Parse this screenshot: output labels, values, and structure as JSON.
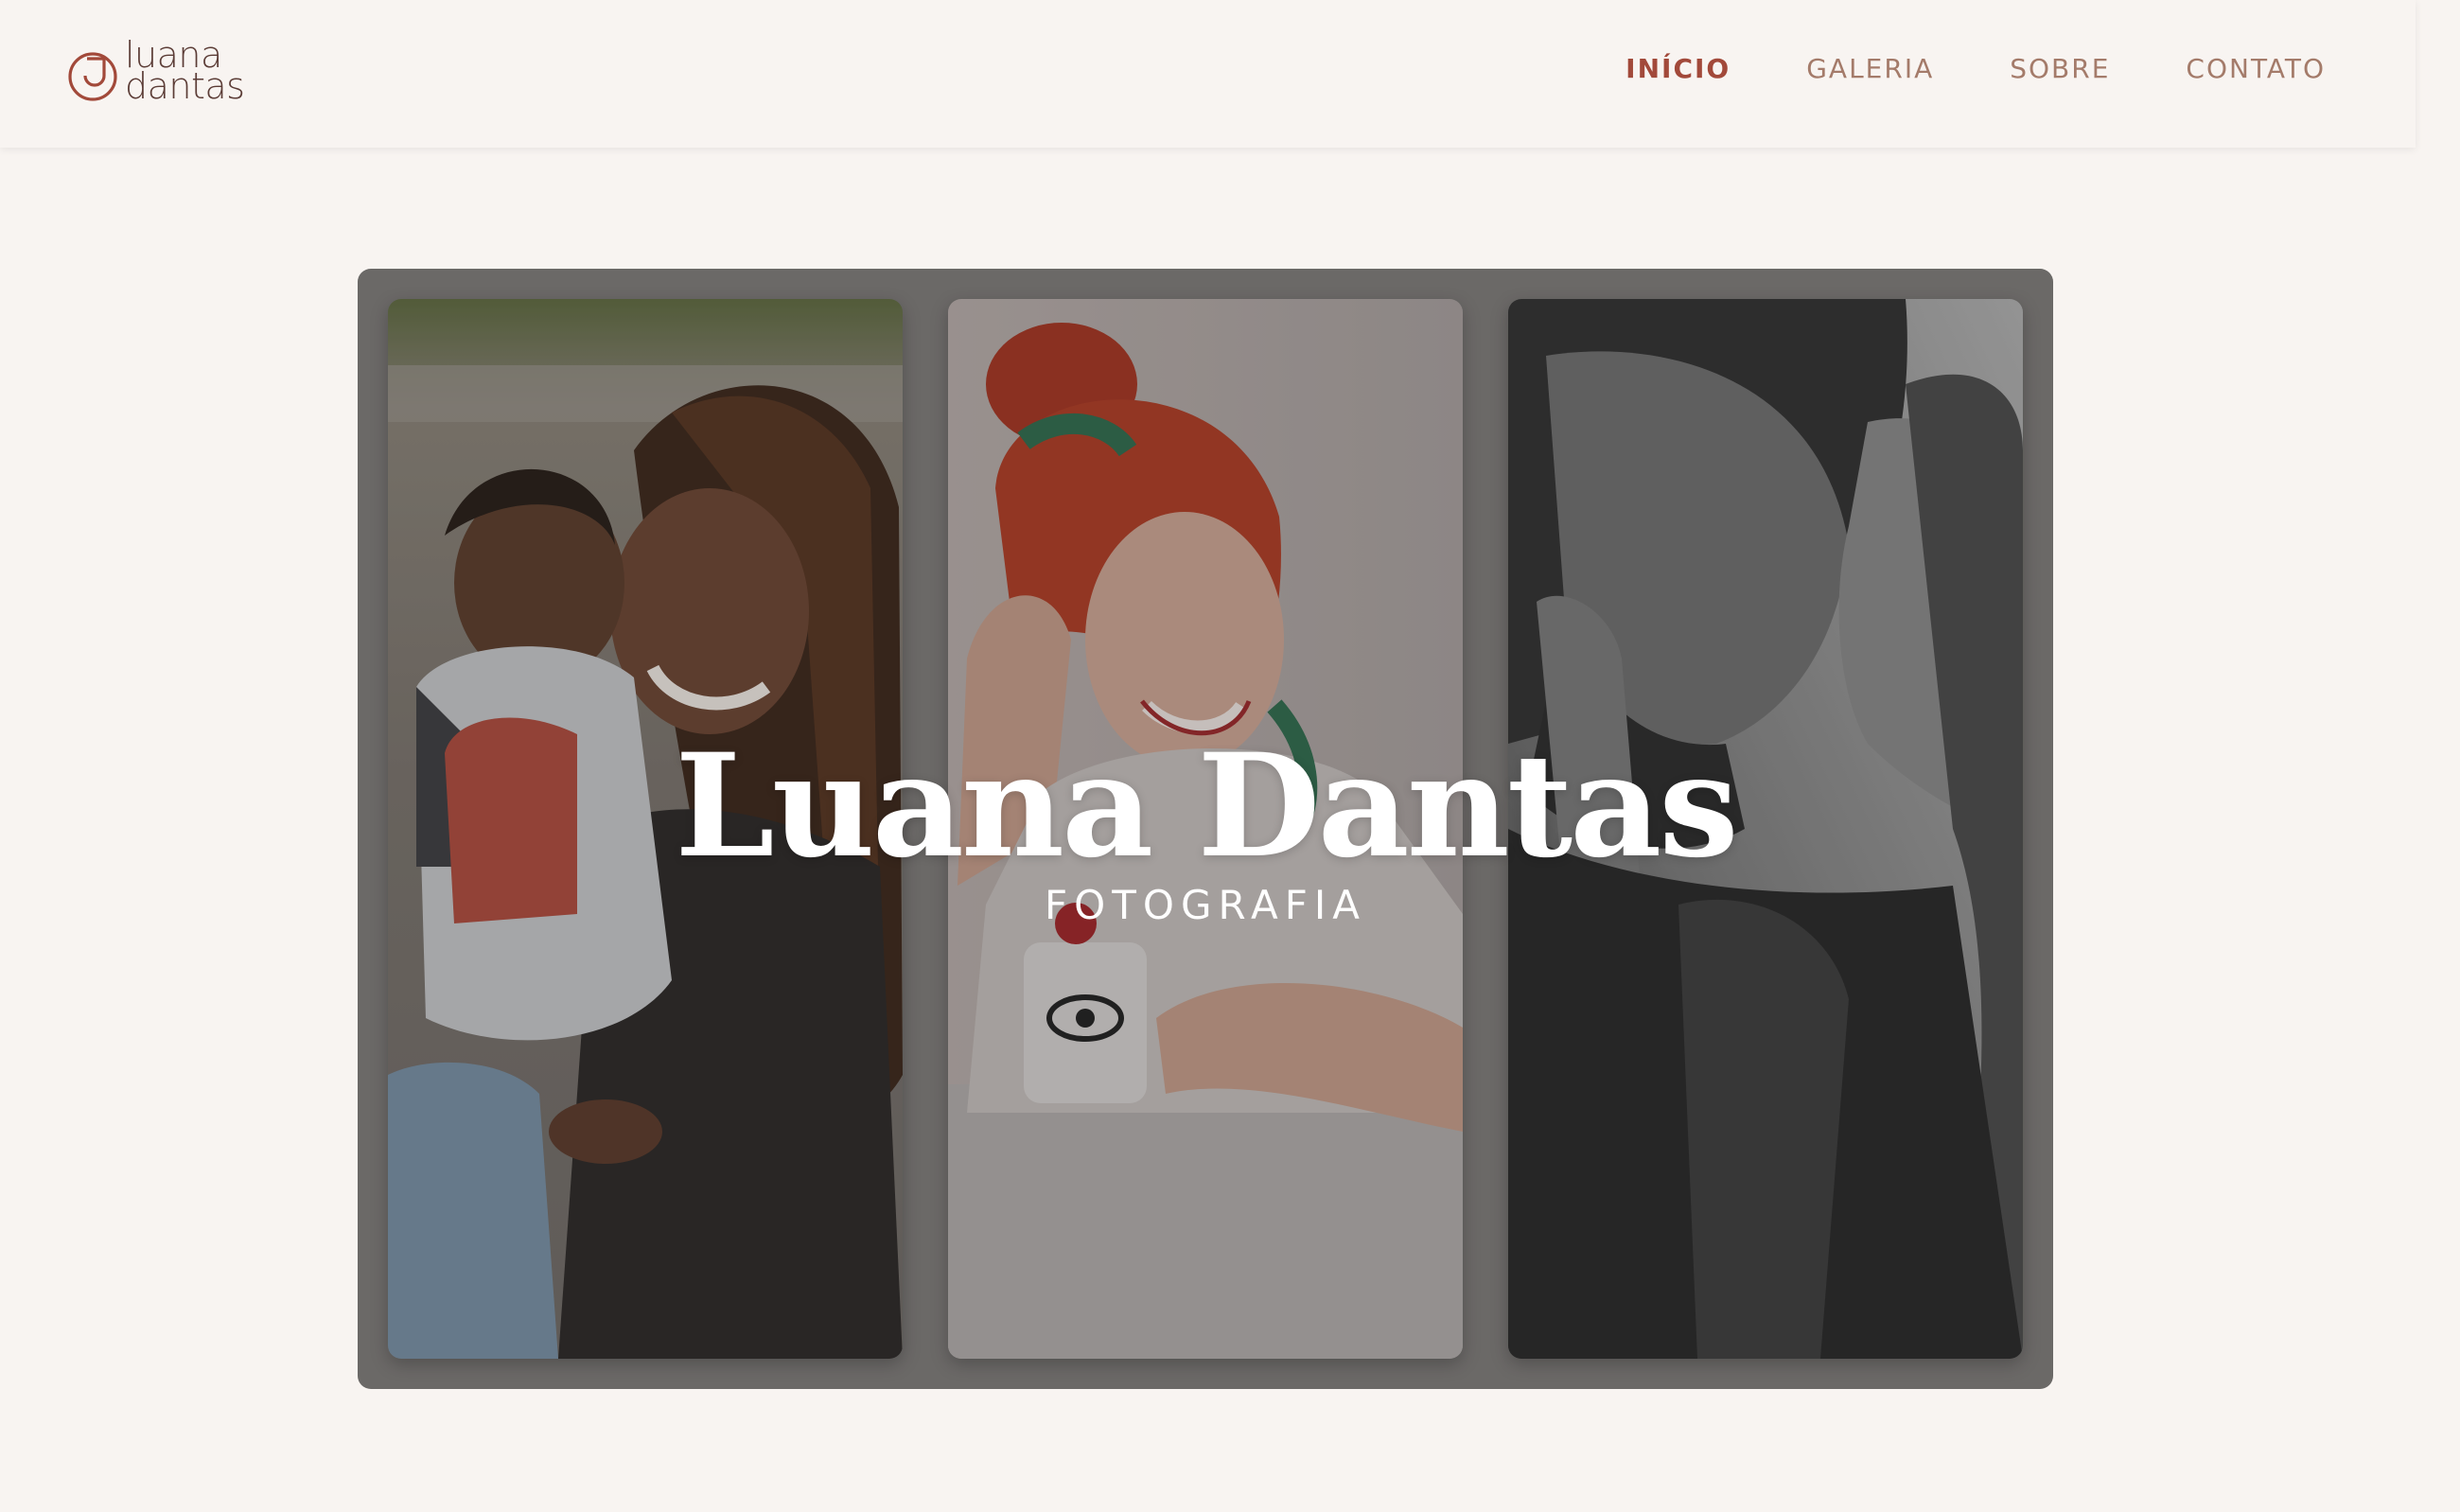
{
  "brand": {
    "line1": "luana",
    "line2": "dantas",
    "accent_color": "#a2493a",
    "text_color": "#5b3c36"
  },
  "nav": {
    "items": [
      {
        "label": "INÍCIO",
        "active": true
      },
      {
        "label": "GALERIA",
        "active": false
      },
      {
        "label": "SOBRE",
        "active": false
      },
      {
        "label": "CONTATO",
        "active": false
      }
    ]
  },
  "hero": {
    "title": "Luana Dantas",
    "subtitle": "FOTOGRAFIA",
    "photos": [
      {
        "icon": "family-photo"
      },
      {
        "icon": "portrait-photo"
      },
      {
        "icon": "couple-photo"
      }
    ]
  },
  "colors": {
    "background": "#f8f4f1",
    "nav_inactive": "#a47b6a",
    "hero_frame": "#7e7b79"
  }
}
